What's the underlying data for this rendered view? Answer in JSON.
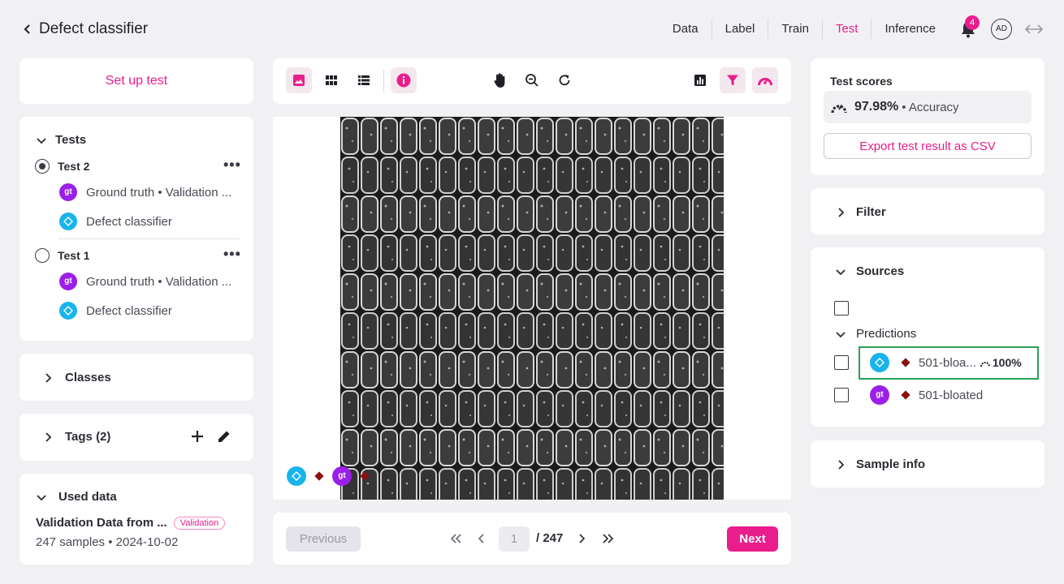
{
  "header": {
    "title": "Defect classifier",
    "nav": [
      "Data",
      "Label",
      "Train",
      "Test",
      "Inference"
    ],
    "active_nav": "Test",
    "notification_count": "4",
    "avatar": "AD"
  },
  "left": {
    "setup_label": "Set up test",
    "tests_title": "Tests",
    "tests": [
      {
        "name": "Test 2",
        "selected": true,
        "gt_label": "Ground truth • Validation ...",
        "model_label": "Defect classifier"
      },
      {
        "name": "Test 1",
        "selected": false,
        "gt_label": "Ground truth • Validation ...",
        "model_label": "Defect classifier"
      }
    ],
    "classes_title": "Classes",
    "tags_title": "Tags (2)",
    "used_title": "Used data",
    "used_name": "Validation Data from ...",
    "used_badge": "Validation",
    "used_meta": "247 samples • 2024-10-02"
  },
  "center": {
    "pager": {
      "previous": "Previous",
      "next": "Next",
      "page": "1",
      "total": "/ 247"
    },
    "overlay": {
      "gt_label": "gt"
    }
  },
  "right": {
    "scores_title": "Test scores",
    "accuracy_value": "97.98%",
    "accuracy_label": "• Accuracy",
    "export_label": "Export test result as CSV",
    "filter_title": "Filter",
    "sources_title": "Sources",
    "predictions_label": "Predictions",
    "prediction_item": {
      "label": "501-bloa...",
      "score": "100%"
    },
    "gt_item": {
      "label": "501-bloated",
      "badge": "gt"
    },
    "sample_info_title": "Sample info"
  },
  "colors": {
    "accent": "#e91e8c",
    "gt": "#9b1fe8",
    "model": "#18b4ec",
    "class": "#8b1010",
    "highlight": "#2aa05a"
  }
}
